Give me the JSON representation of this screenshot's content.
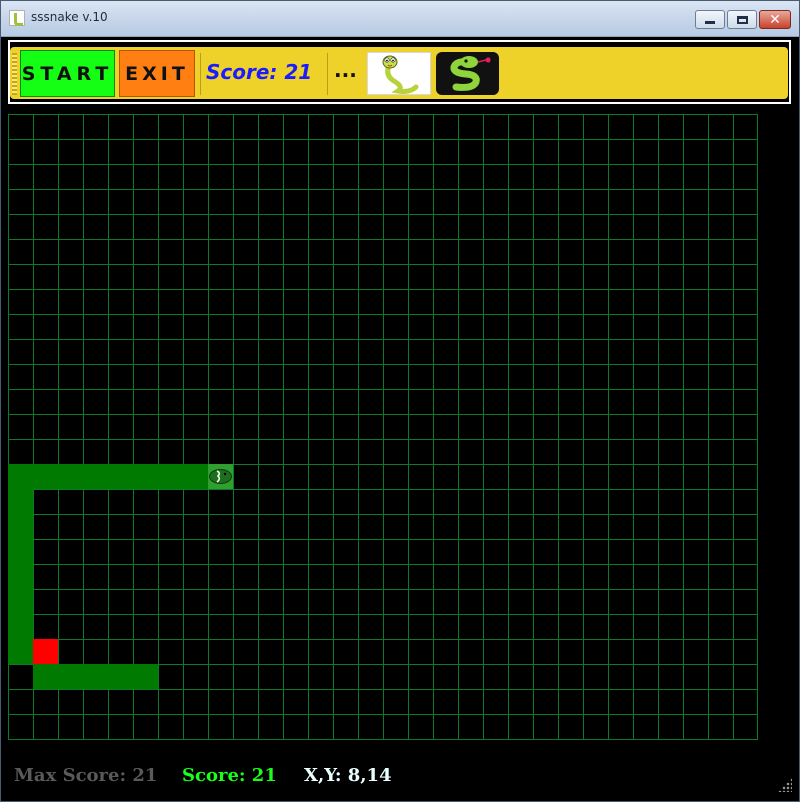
{
  "window": {
    "title": "sssnake v.10",
    "controls": {
      "minimize": "–",
      "maximize": "□",
      "close": "✕"
    }
  },
  "toolbar": {
    "start_label": "START",
    "exit_label": "EXIT",
    "score_label": "Score: 21",
    "more_label": "...",
    "images": [
      "snake-cartoon-icon",
      "snake-logo-icon"
    ]
  },
  "board": {
    "columns": 30,
    "rows": 25,
    "grid_color": "#0b7a2b",
    "snake_color": "#007a00",
    "head_color": "#2f9f2f",
    "food_color": "#ff0000",
    "snake_body": [
      [
        0,
        14
      ],
      [
        1,
        14
      ],
      [
        2,
        14
      ],
      [
        3,
        14
      ],
      [
        4,
        14
      ],
      [
        5,
        14
      ],
      [
        6,
        14
      ],
      [
        7,
        14
      ],
      [
        0,
        15
      ],
      [
        0,
        16
      ],
      [
        0,
        17
      ],
      [
        0,
        18
      ],
      [
        0,
        19
      ],
      [
        0,
        20
      ],
      [
        0,
        21
      ],
      [
        1,
        22
      ],
      [
        2,
        22
      ],
      [
        3,
        22
      ],
      [
        4,
        22
      ],
      [
        5,
        22
      ]
    ],
    "snake_head": [
      8,
      14
    ],
    "food": [
      1,
      21
    ]
  },
  "status": {
    "max_score": "Max Score: 21",
    "score": "Score: 21",
    "xy": "X,Y: 8,14"
  }
}
